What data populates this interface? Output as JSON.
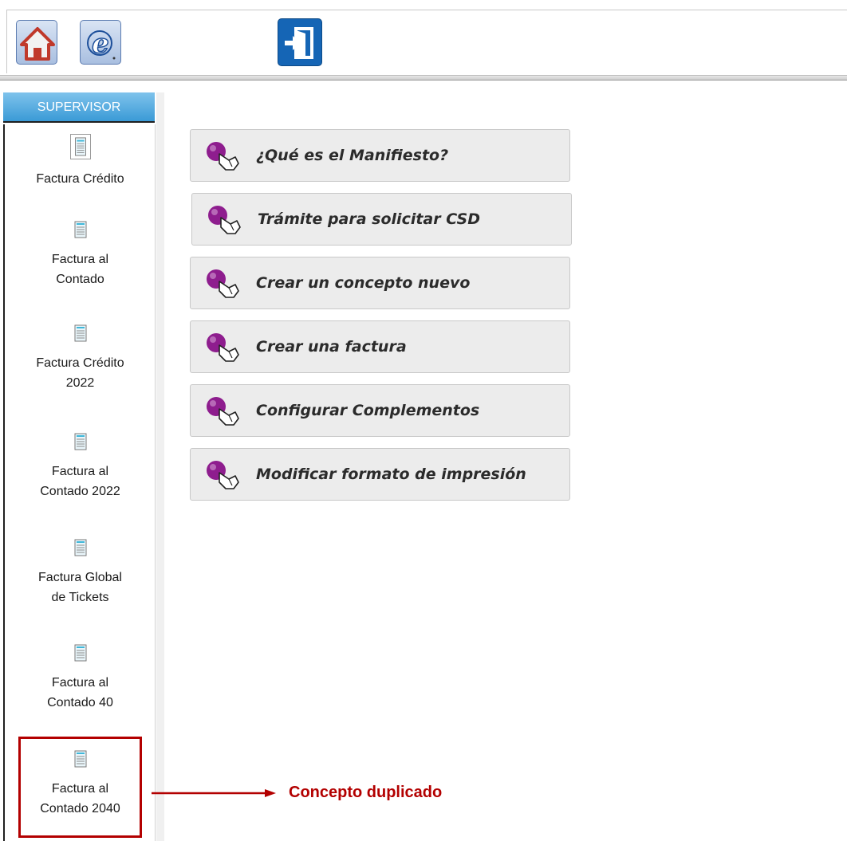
{
  "toolbar": {
    "home_icon": "home-icon",
    "web_icon": "web-e-icon",
    "exit_icon": "exit-door-icon"
  },
  "sidebar": {
    "tab_label": "SUPERVISOR",
    "items": [
      {
        "label_lines": [
          "Factura Crédito"
        ]
      },
      {
        "label_lines": [
          "Factura al",
          "Contado"
        ]
      },
      {
        "label_lines": [
          "Factura Crédito",
          "2022"
        ]
      },
      {
        "label_lines": [
          "Factura al",
          "Contado 2022"
        ]
      },
      {
        "label_lines": [
          "Factura Global",
          "de Tickets"
        ]
      },
      {
        "label_lines": [
          "Factura al",
          "Contado 40"
        ]
      },
      {
        "label_lines": [
          "Factura al",
          "Contado 2040"
        ]
      }
    ]
  },
  "main": {
    "buttons": [
      {
        "label": "¿Qué es el Manifiesto?"
      },
      {
        "label": "Trámite para solicitar CSD"
      },
      {
        "label": "Crear un concepto nuevo"
      },
      {
        "label": "Crear una factura"
      },
      {
        "label": "Configurar Complementos"
      },
      {
        "label": "Modificar formato de impresión"
      }
    ]
  },
  "annotation": {
    "text": "Concepto duplicado",
    "color": "#b30000"
  },
  "colors": {
    "tab_blue": "#3a9ad6",
    "exit_blue": "#1565b5",
    "bubble_purple": "#8e1d8e"
  }
}
